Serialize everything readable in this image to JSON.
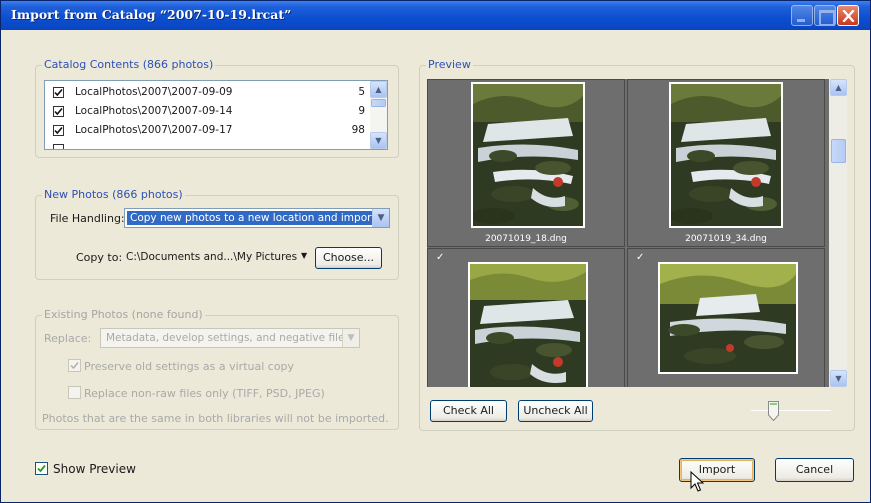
{
  "window": {
    "title": "Import from Catalog “2007-10-19.lrcat”",
    "title_icon_names": [
      "minimize-icon",
      "maximize-icon",
      "close-icon"
    ]
  },
  "catalog": {
    "legend": "Catalog Contents (866 photos)",
    "rows": [
      {
        "path": "LocalPhotos\\2007\\2007-09-09",
        "count": "5",
        "checked": true
      },
      {
        "path": "LocalPhotos\\2007\\2007-09-14",
        "count": "9",
        "checked": true
      },
      {
        "path": "LocalPhotos\\2007\\2007-09-17",
        "count": "98",
        "checked": true
      }
    ]
  },
  "new_photos": {
    "legend": "New Photos (866 photos)",
    "file_handling_label": "File Handling:",
    "file_handling_value": "Copy new photos to a new location and import",
    "copy_to_label": "Copy to:",
    "copy_to_value": "C:\\Documents and...\\My Pictures",
    "choose_button": "Choose..."
  },
  "existing": {
    "legend": "Existing Photos (none found)",
    "replace_label": "Replace:",
    "replace_value": "Metadata, develop settings, and negative files",
    "preserve_label": "Preserve old settings as a virtual copy",
    "preserve_checked": true,
    "nonraw_label": "Replace non-raw files only (TIFF, PSD, JPEG)",
    "nonraw_checked": false,
    "note": "Photos that are the same in both libraries will not be imported."
  },
  "preview": {
    "legend": "Preview",
    "thumbnails": [
      {
        "caption": "20071019_18.dng",
        "checked": true
      },
      {
        "caption": "20071019_34.dng",
        "checked": true
      },
      {
        "caption": "",
        "checked": true
      },
      {
        "caption": "",
        "checked": true
      }
    ],
    "check_all": "Check All",
    "uncheck_all": "Uncheck All",
    "thumbnail_size": 0.4
  },
  "footer": {
    "show_preview_label": "Show Preview",
    "show_preview_checked": true,
    "import_button": "Import",
    "cancel_button": "Cancel"
  },
  "colors": {
    "titlebar": "#0b4fd0",
    "dialog_bg": "#ece9d8",
    "group_legend": "#2f4fb5",
    "selection": "#316ac5",
    "preview_bg": "#6e6e6e"
  }
}
